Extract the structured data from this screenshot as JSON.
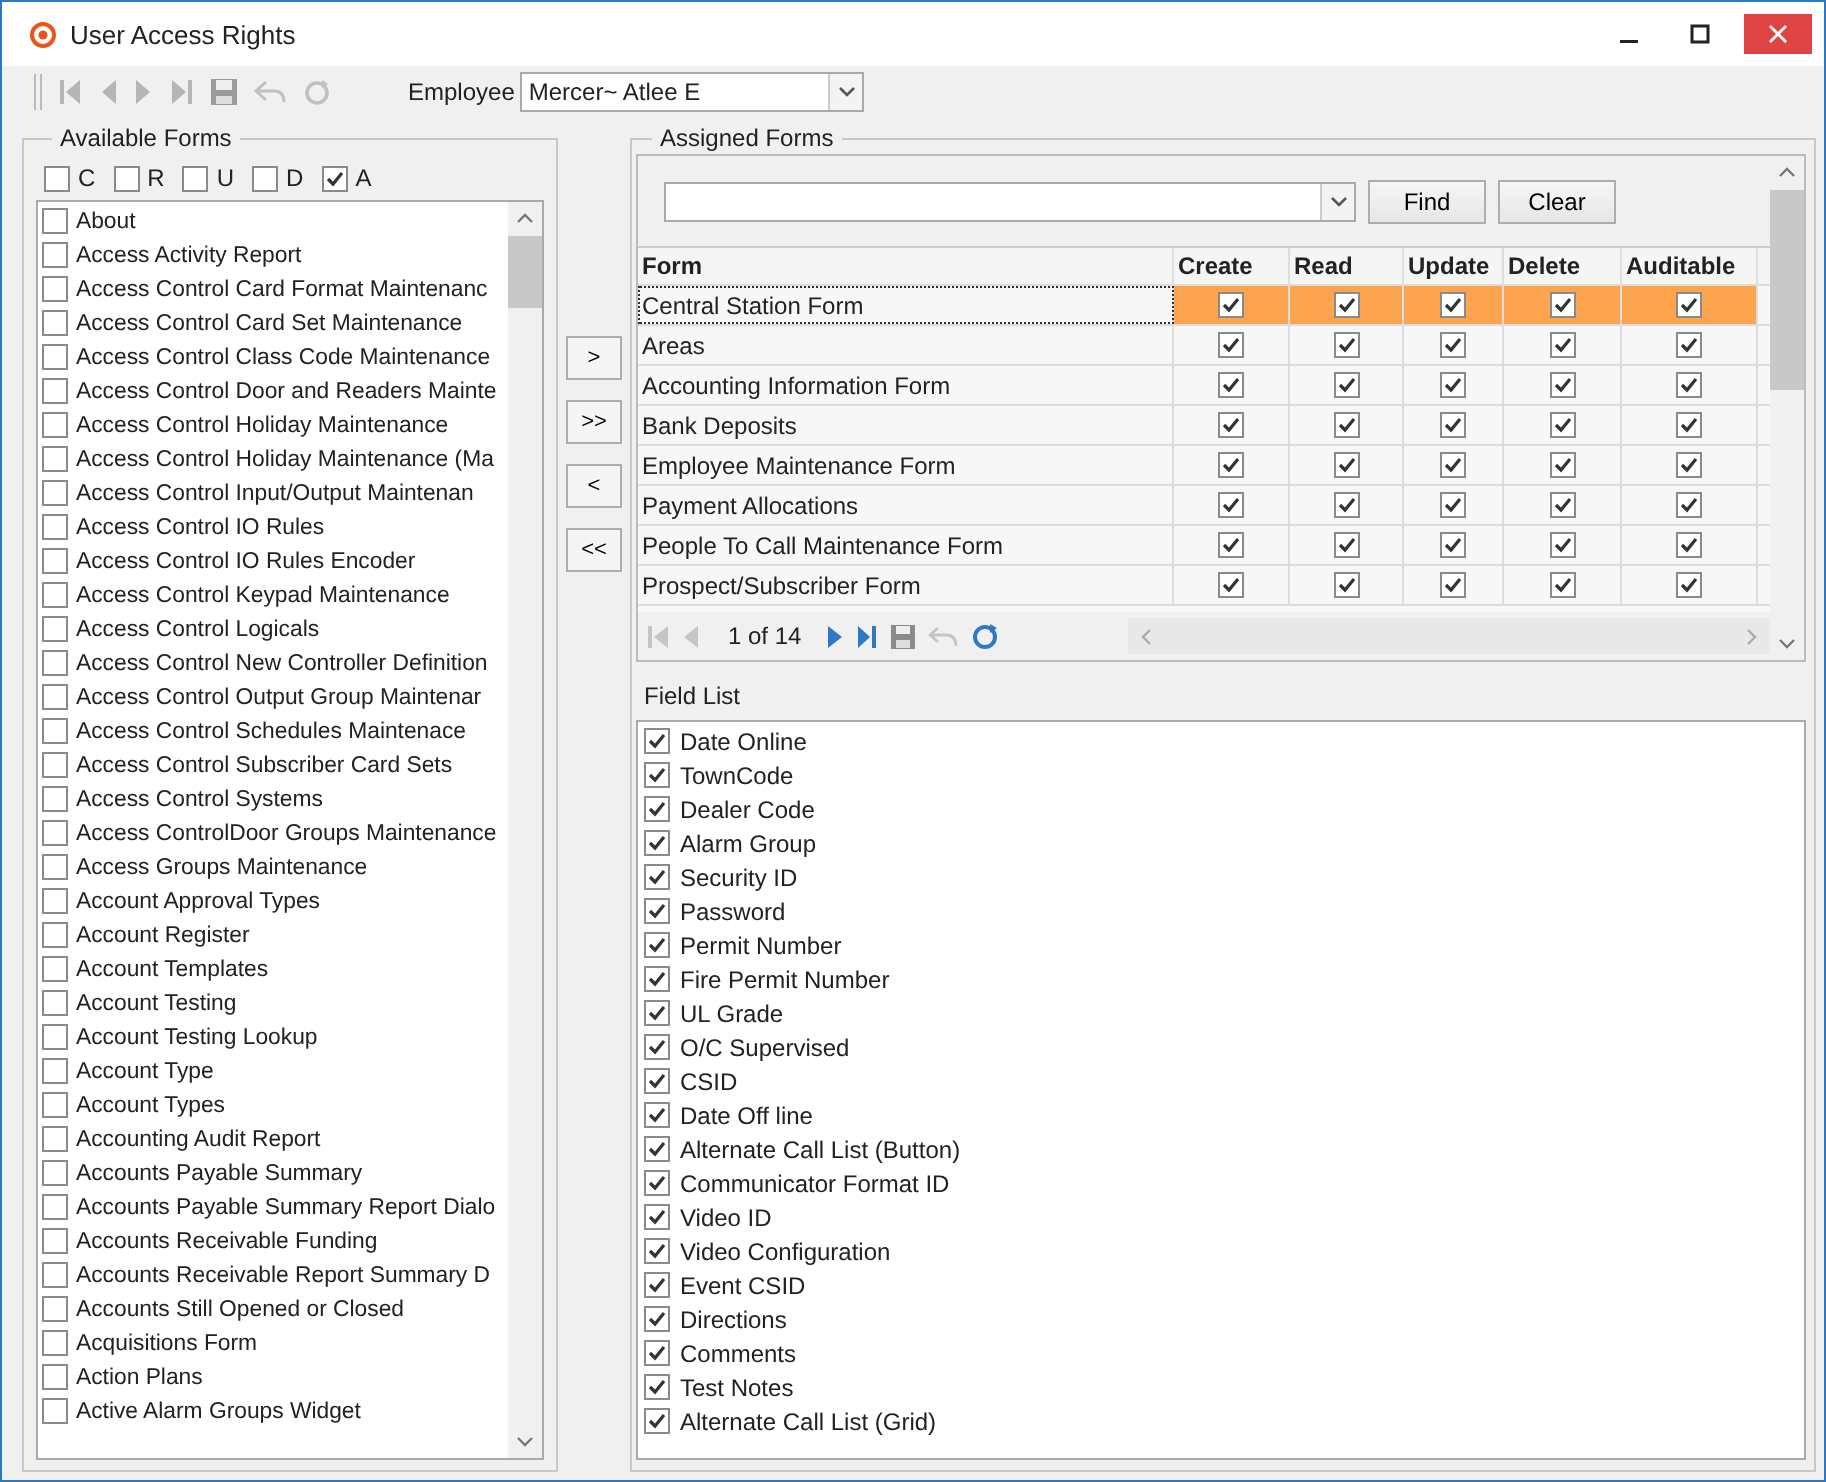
{
  "window": {
    "title": "User Access Rights"
  },
  "toolbar": {
    "employee_label": "Employee",
    "employee": "Mercer~ Atlee E"
  },
  "available_forms": {
    "title": "Available Forms",
    "filters": [
      {
        "label": "C",
        "checked": false
      },
      {
        "label": "R",
        "checked": false
      },
      {
        "label": "U",
        "checked": false
      },
      {
        "label": "D",
        "checked": false
      },
      {
        "label": "A",
        "checked": true
      }
    ],
    "items": [
      {
        "label": "About",
        "checked": false
      },
      {
        "label": "Access Activity Report",
        "checked": false
      },
      {
        "label": "Access Control Card Format Maintenanc",
        "checked": false
      },
      {
        "label": "Access Control Card Set Maintenance",
        "checked": false
      },
      {
        "label": "Access Control Class Code Maintenance",
        "checked": false
      },
      {
        "label": "Access Control Door and Readers Mainte",
        "checked": false
      },
      {
        "label": "Access Control Holiday Maintenance",
        "checked": false
      },
      {
        "label": "Access Control Holiday Maintenance (Ma",
        "checked": false
      },
      {
        "label": "Access Control Input/Output Maintenan",
        "checked": false
      },
      {
        "label": "Access Control IO Rules",
        "checked": false
      },
      {
        "label": "Access Control IO Rules Encoder",
        "checked": false
      },
      {
        "label": "Access Control Keypad Maintenance",
        "checked": false
      },
      {
        "label": "Access Control Logicals",
        "checked": false
      },
      {
        "label": "Access Control New Controller Definition",
        "checked": false
      },
      {
        "label": "Access Control Output Group Maintenar",
        "checked": false
      },
      {
        "label": "Access Control Schedules Maintenace",
        "checked": false
      },
      {
        "label": "Access Control Subscriber Card Sets",
        "checked": false
      },
      {
        "label": "Access Control Systems",
        "checked": false
      },
      {
        "label": "Access ControlDoor Groups Maintenance",
        "checked": false
      },
      {
        "label": "Access Groups Maintenance",
        "checked": false
      },
      {
        "label": "Account Approval Types",
        "checked": false
      },
      {
        "label": "Account Register",
        "checked": false
      },
      {
        "label": "Account Templates",
        "checked": false
      },
      {
        "label": "Account Testing",
        "checked": false
      },
      {
        "label": "Account Testing Lookup",
        "checked": false
      },
      {
        "label": "Account Type",
        "checked": false
      },
      {
        "label": "Account Types",
        "checked": false
      },
      {
        "label": "Accounting Audit Report",
        "checked": false
      },
      {
        "label": "Accounts Payable Summary",
        "checked": false
      },
      {
        "label": "Accounts Payable Summary Report Dialo",
        "checked": false
      },
      {
        "label": "Accounts Receivable Funding",
        "checked": false
      },
      {
        "label": "Accounts Receivable Report Summary D",
        "checked": false
      },
      {
        "label": "Accounts Still Opened or Closed",
        "checked": false
      },
      {
        "label": "Acquisitions Form",
        "checked": false
      },
      {
        "label": "Action Plans",
        "checked": false
      },
      {
        "label": "Active Alarm Groups Widget",
        "checked": false
      }
    ]
  },
  "move_buttons": [
    ">",
    ">>",
    "<",
    "<<"
  ],
  "assigned_forms": {
    "title": "Assigned Forms",
    "find_button": "Find",
    "clear_button": "Clear",
    "columns": [
      "Form",
      "Create",
      "Read",
      "Update",
      "Delete",
      "Auditable"
    ],
    "rows": [
      {
        "form": "Central Station Form",
        "create": true,
        "read": true,
        "update": true,
        "delete": true,
        "auditable": true,
        "selected": true
      },
      {
        "form": "Areas",
        "create": true,
        "read": true,
        "update": true,
        "delete": true,
        "auditable": true,
        "selected": false
      },
      {
        "form": "Accounting Information Form",
        "create": true,
        "read": true,
        "update": true,
        "delete": true,
        "auditable": true,
        "selected": false
      },
      {
        "form": "Bank Deposits",
        "create": true,
        "read": true,
        "update": true,
        "delete": true,
        "auditable": true,
        "selected": false
      },
      {
        "form": "Employee Maintenance Form",
        "create": true,
        "read": true,
        "update": true,
        "delete": true,
        "auditable": true,
        "selected": false
      },
      {
        "form": "Payment Allocations",
        "create": true,
        "read": true,
        "update": true,
        "delete": true,
        "auditable": true,
        "selected": false
      },
      {
        "form": "People To Call Maintenance Form",
        "create": true,
        "read": true,
        "update": true,
        "delete": true,
        "auditable": true,
        "selected": false
      },
      {
        "form": "Prospect/Subscriber Form",
        "create": true,
        "read": true,
        "update": true,
        "delete": true,
        "auditable": true,
        "selected": false
      }
    ],
    "pager": "1 of 14"
  },
  "field_list": {
    "title": "Field List",
    "items": [
      {
        "label": "Date Online",
        "checked": true
      },
      {
        "label": "TownCode",
        "checked": true
      },
      {
        "label": "Dealer Code",
        "checked": true
      },
      {
        "label": "Alarm Group",
        "checked": true
      },
      {
        "label": "Security ID",
        "checked": true
      },
      {
        "label": "Password",
        "checked": true
      },
      {
        "label": "Permit Number",
        "checked": true
      },
      {
        "label": "Fire Permit Number",
        "checked": true
      },
      {
        "label": "UL Grade",
        "checked": true
      },
      {
        "label": "O/C Supervised",
        "checked": true
      },
      {
        "label": "CSID",
        "checked": true
      },
      {
        "label": "Date Off line",
        "checked": true
      },
      {
        "label": "Alternate Call List (Button)",
        "checked": true
      },
      {
        "label": "Communicator Format ID",
        "checked": true
      },
      {
        "label": "Video ID",
        "checked": true
      },
      {
        "label": "Video Configuration",
        "checked": true
      },
      {
        "label": "Event CSID",
        "checked": true
      },
      {
        "label": "Directions",
        "checked": true
      },
      {
        "label": "Comments",
        "checked": true
      },
      {
        "label": "Test Notes",
        "checked": true
      },
      {
        "label": "Alternate Call List (Grid)",
        "checked": true
      }
    ]
  }
}
